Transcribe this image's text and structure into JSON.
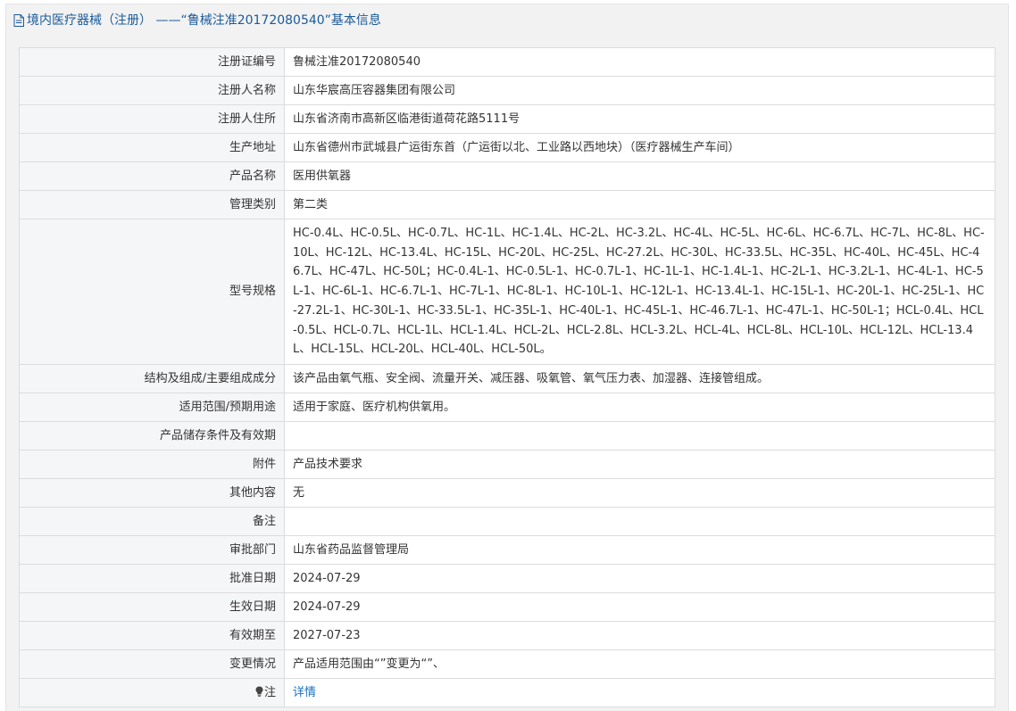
{
  "page": {
    "title": "境内医疗器械（注册） ——“鲁械注准20172080540”基本信息"
  },
  "rows": [
    {
      "label": "注册证编号",
      "value": "鲁械注准20172080540"
    },
    {
      "label": "注册人名称",
      "value": "山东华宸高压容器集团有限公司"
    },
    {
      "label": "注册人住所",
      "value": "山东省济南市高新区临港街道荷花路5111号"
    },
    {
      "label": "生产地址",
      "value": "山东省德州市武城县广运街东首（广运街以北、工业路以西地块）（医疗器械生产车间）"
    },
    {
      "label": "产品名称",
      "value": "医用供氧器"
    },
    {
      "label": "管理类别",
      "value": "第二类"
    },
    {
      "label": "型号规格",
      "value": "HC-0.4L、HC-0.5L、HC-0.7L、HC-1L、HC-1.4L、HC-2L、HC-3.2L、HC-4L、HC-5L、HC-6L、HC-6.7L、HC-7L、HC-8L、HC-10L、HC-12L、HC-13.4L、HC-15L、HC-20L、HC-25L、HC-27.2L、HC-30L、HC-33.5L、HC-35L、HC-40L、HC-45L、HC-46.7L、HC-47L、HC-50L；HC-0.4L-1、HC-0.5L-1、HC-0.7L-1、HC-1L-1、HC-1.4L-1、HC-2L-1、HC-3.2L-1、HC-4L-1、HC-5L-1、HC-6L-1、HC-6.7L-1、HC-7L-1、HC-8L-1、HC-10L-1、HC-12L-1、HC-13.4L-1、HC-15L-1、HC-20L-1、HC-25L-1、HC-27.2L-1、HC-30L-1、HC-33.5L-1、HC-35L-1、HC-40L-1、HC-45L-1、HC-46.7L-1、HC-47L-1、HC-50L-1；HCL-0.4L、HCL-0.5L、HCL-0.7L、HCL-1L、HCL-1.4L、HCL-2L、HCL-2.8L、HCL-3.2L、HCL-4L、HCL-8L、HCL-10L、HCL-12L、HCL-13.4L、HCL-15L、HCL-20L、HCL-40L、HCL-50L。"
    },
    {
      "label": "结构及组成/主要组成成分",
      "value": "该产品由氧气瓶、安全阀、流量开关、减压器、吸氧管、氧气压力表、加湿器、连接管组成。"
    },
    {
      "label": "适用范围/预期用途",
      "value": "适用于家庭、医疗机构供氧用。"
    },
    {
      "label": "产品储存条件及有效期",
      "value": ""
    },
    {
      "label": "附件",
      "value": "产品技术要求"
    },
    {
      "label": "其他内容",
      "value": "无"
    },
    {
      "label": "备注",
      "value": ""
    },
    {
      "label": "审批部门",
      "value": "山东省药品监督管理局"
    },
    {
      "label": "批准日期",
      "value": "2024-07-29"
    },
    {
      "label": "生效日期",
      "value": "2024-07-29"
    },
    {
      "label": "有效期至",
      "value": "2027-07-23"
    },
    {
      "label": "变更情况",
      "value": "产品适用范围由“”变更为“”、"
    },
    {
      "label": "注",
      "value": "详情"
    }
  ],
  "icons": {
    "title_icon": "document-icon",
    "note_icon": "lightbulb-icon"
  },
  "colors": {
    "title_text": "#1a5a9a",
    "link": "#1b6fc2",
    "label_bg": "#f5f6f8",
    "border": "#dcdcdc"
  }
}
